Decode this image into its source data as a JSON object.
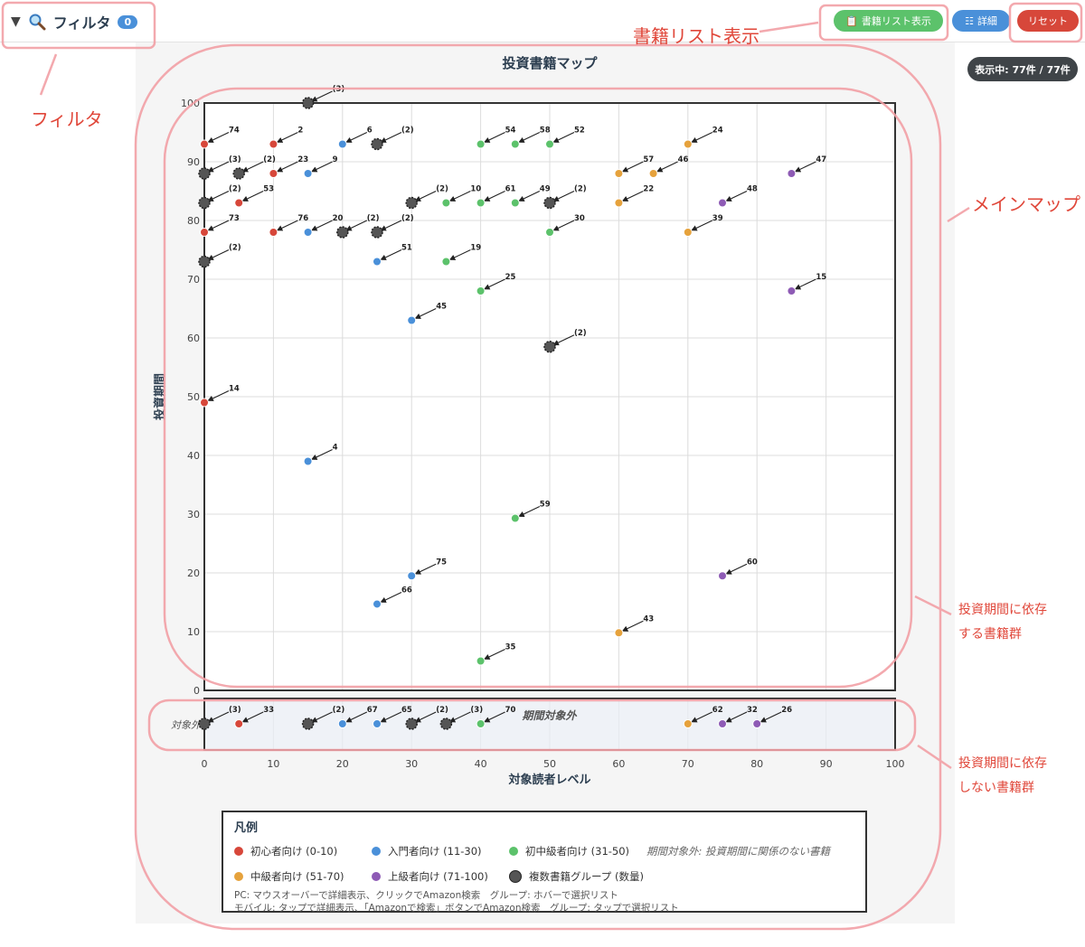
{
  "toolbar": {
    "filter_label": "フィルタ",
    "filter_count": "0",
    "list_button": "書籍リスト表示",
    "detail_button": "詳細",
    "reset_button": "リセット"
  },
  "count_badge": "表示中: 77件 / 77件",
  "annotations": {
    "filter": "フィルタ",
    "book_list": "書籍リスト表示",
    "main_map": "メインマップ",
    "dependent_1": "投資期間に依存",
    "dependent_2": "する書籍群",
    "independent_1": "投資期間に依存",
    "independent_2": "しない書籍群"
  },
  "colors": {
    "beginner": "#d7473a",
    "intro": "#4a90d9",
    "lower_mid": "#5cc26b",
    "mid": "#e6a23c",
    "advanced": "#8e5bb5",
    "group": "#555555",
    "annotation": "#e0473a"
  },
  "legend": {
    "title": "凡例",
    "items": [
      {
        "label": "初心者向け (0-10)",
        "color": "#d7473a"
      },
      {
        "label": "入門者向け (11-30)",
        "color": "#4a90d9"
      },
      {
        "label": "初中級者向け (31-50)",
        "color": "#5cc26b"
      },
      {
        "label": "中級者向け (51-70)",
        "color": "#e6a23c"
      },
      {
        "label": "上級者向け (71-100)",
        "color": "#8e5bb5"
      },
      {
        "label": "複数書籍グループ (数量)",
        "color": "#555555"
      }
    ],
    "note": "期間対象外: 投資期間に関係のない書籍",
    "help_pc": "PC: マウスオーバーで詳細表示、クリックでAmazon検索　グループ: ホバーで選択リスト",
    "help_mobile": "モバイル: タップで詳細表示、「Amazonで検索」ボタンでAmazon検索　グループ: タップで選択リスト"
  },
  "chart_data": {
    "type": "scatter",
    "title": "投資書籍マップ",
    "xlabel": "対象読者レベル",
    "ylabel": "投資期間",
    "xlim": [
      0,
      100
    ],
    "ylim": [
      0,
      100
    ],
    "xticks": [
      "0",
      "10",
      "20",
      "30",
      "40",
      "50",
      "60",
      "70",
      "80",
      "90",
      "100"
    ],
    "yticks": [
      "0",
      "10",
      "20",
      "30",
      "40",
      "50",
      "60",
      "70",
      "80",
      "90",
      "100"
    ],
    "out_of_scope_label": "対象外",
    "out_of_scope_title": "期間対象外",
    "grid": true,
    "points": [
      {
        "x": 15,
        "y": 100,
        "label": "(3)",
        "cat": "group"
      },
      {
        "x": 0,
        "y": 93,
        "label": "74",
        "cat": "beginner"
      },
      {
        "x": 10,
        "y": 93,
        "label": "2",
        "cat": "beginner"
      },
      {
        "x": 20,
        "y": 93,
        "label": "6",
        "cat": "intro"
      },
      {
        "x": 25,
        "y": 93,
        "label": "(2)",
        "cat": "group"
      },
      {
        "x": 40,
        "y": 93,
        "label": "54",
        "cat": "lower_mid"
      },
      {
        "x": 45,
        "y": 93,
        "label": "58",
        "cat": "lower_mid"
      },
      {
        "x": 50,
        "y": 93,
        "label": "52",
        "cat": "lower_mid"
      },
      {
        "x": 70,
        "y": 93,
        "label": "24",
        "cat": "mid"
      },
      {
        "x": 0,
        "y": 88,
        "label": "(3)",
        "cat": "group"
      },
      {
        "x": 5,
        "y": 88,
        "label": "(2)",
        "cat": "group"
      },
      {
        "x": 10,
        "y": 88,
        "label": "23",
        "cat": "beginner"
      },
      {
        "x": 15,
        "y": 88,
        "label": "9",
        "cat": "intro"
      },
      {
        "x": 60,
        "y": 88,
        "label": "57",
        "cat": "mid"
      },
      {
        "x": 65,
        "y": 88,
        "label": "46",
        "cat": "mid"
      },
      {
        "x": 85,
        "y": 88,
        "label": "47",
        "cat": "advanced"
      },
      {
        "x": 0,
        "y": 83,
        "label": "(2)",
        "cat": "group"
      },
      {
        "x": 5,
        "y": 83,
        "label": "53",
        "cat": "beginner"
      },
      {
        "x": 30,
        "y": 83,
        "label": "(2)",
        "cat": "group"
      },
      {
        "x": 35,
        "y": 83,
        "label": "10",
        "cat": "lower_mid"
      },
      {
        "x": 40,
        "y": 83,
        "label": "61",
        "cat": "lower_mid"
      },
      {
        "x": 45,
        "y": 83,
        "label": "49",
        "cat": "lower_mid"
      },
      {
        "x": 50,
        "y": 83,
        "label": "(2)",
        "cat": "group"
      },
      {
        "x": 60,
        "y": 83,
        "label": "22",
        "cat": "mid"
      },
      {
        "x": 75,
        "y": 83,
        "label": "48",
        "cat": "advanced"
      },
      {
        "x": 0,
        "y": 78,
        "label": "73",
        "cat": "beginner"
      },
      {
        "x": 10,
        "y": 78,
        "label": "76",
        "cat": "beginner"
      },
      {
        "x": 15,
        "y": 78,
        "label": "20",
        "cat": "intro"
      },
      {
        "x": 20,
        "y": 78,
        "label": "(2)",
        "cat": "group"
      },
      {
        "x": 25,
        "y": 78,
        "label": "(2)",
        "cat": "group"
      },
      {
        "x": 50,
        "y": 78,
        "label": "30",
        "cat": "lower_mid"
      },
      {
        "x": 70,
        "y": 78,
        "label": "39",
        "cat": "mid"
      },
      {
        "x": 0,
        "y": 73,
        "label": "(2)",
        "cat": "group"
      },
      {
        "x": 25,
        "y": 73,
        "label": "51",
        "cat": "intro"
      },
      {
        "x": 35,
        "y": 73,
        "label": "19",
        "cat": "lower_mid"
      },
      {
        "x": 40,
        "y": 68,
        "label": "25",
        "cat": "lower_mid"
      },
      {
        "x": 85,
        "y": 68,
        "label": "15",
        "cat": "advanced"
      },
      {
        "x": 30,
        "y": 63,
        "label": "45",
        "cat": "intro"
      },
      {
        "x": 50,
        "y": 58.5,
        "label": "(2)",
        "cat": "group"
      },
      {
        "x": 0,
        "y": 49,
        "label": "14",
        "cat": "beginner"
      },
      {
        "x": 15,
        "y": 39,
        "label": "4",
        "cat": "intro"
      },
      {
        "x": 45,
        "y": 29.3,
        "label": "59",
        "cat": "lower_mid"
      },
      {
        "x": 30,
        "y": 19.5,
        "label": "75",
        "cat": "intro"
      },
      {
        "x": 75,
        "y": 19.5,
        "label": "60",
        "cat": "advanced"
      },
      {
        "x": 25,
        "y": 14.7,
        "label": "66",
        "cat": "intro"
      },
      {
        "x": 60,
        "y": 9.8,
        "label": "43",
        "cat": "mid"
      },
      {
        "x": 40,
        "y": 5,
        "label": "35",
        "cat": "lower_mid"
      }
    ],
    "out_of_scope_points": [
      {
        "x": 0,
        "label": "(3)",
        "cat": "group"
      },
      {
        "x": 5,
        "label": "33",
        "cat": "beginner"
      },
      {
        "x": 15,
        "label": "(2)",
        "cat": "group"
      },
      {
        "x": 20,
        "label": "67",
        "cat": "intro"
      },
      {
        "x": 25,
        "label": "65",
        "cat": "intro"
      },
      {
        "x": 30,
        "label": "(2)",
        "cat": "group"
      },
      {
        "x": 35,
        "label": "(3)",
        "cat": "group"
      },
      {
        "x": 40,
        "label": "70",
        "cat": "lower_mid"
      },
      {
        "x": 70,
        "label": "62",
        "cat": "mid"
      },
      {
        "x": 75,
        "label": "32",
        "cat": "advanced"
      },
      {
        "x": 80,
        "label": "26",
        "cat": "advanced"
      }
    ]
  }
}
